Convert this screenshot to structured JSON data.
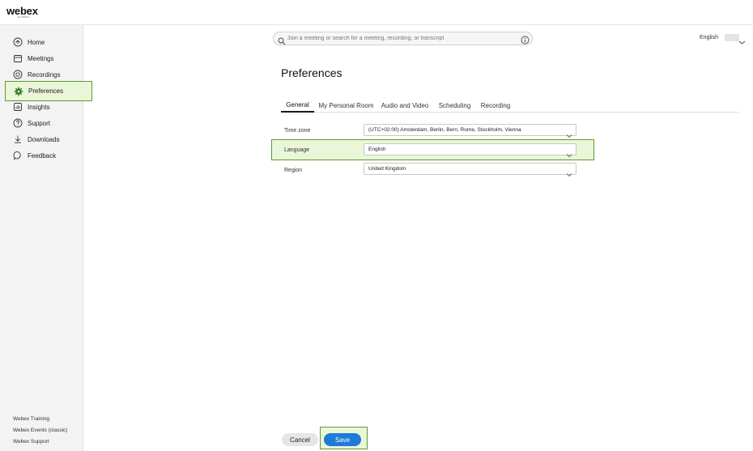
{
  "brand": {
    "logo_text": "webex",
    "logo_subtext": "by CISCO"
  },
  "search": {
    "placeholder": "Join a meeting or search for a meeting, recording, or transcript"
  },
  "header": {
    "language": "English"
  },
  "sidebar": {
    "items": [
      {
        "label": "Home",
        "icon": "home-icon"
      },
      {
        "label": "Meetings",
        "icon": "calendar-icon"
      },
      {
        "label": "Recordings",
        "icon": "record-icon"
      },
      {
        "label": "Preferences",
        "icon": "gear-icon"
      },
      {
        "label": "Insights",
        "icon": "chart-icon"
      },
      {
        "label": "Support",
        "icon": "help-icon"
      },
      {
        "label": "Downloads",
        "icon": "download-icon"
      },
      {
        "label": "Feedback",
        "icon": "feedback-icon"
      }
    ],
    "active_index": 3,
    "footer_links": [
      "Webex Training",
      "Webex Events (classic)",
      "Webex Support"
    ]
  },
  "main": {
    "title": "Preferences",
    "tabs": [
      {
        "label": "General"
      },
      {
        "label": "My Personal Room"
      },
      {
        "label": "Audio and Video"
      },
      {
        "label": "Scheduling"
      },
      {
        "label": "Recording"
      }
    ],
    "active_tab": 0,
    "fields": {
      "timezone": {
        "label": "Time zone",
        "value": "(UTC+02:00) Amsterdam, Berlin, Bern, Rome, Stockholm, Vienna"
      },
      "language": {
        "label": "Language",
        "value": "English"
      },
      "region": {
        "label": "Region",
        "value": "United Kingdom"
      }
    },
    "actions": {
      "cancel": "Cancel",
      "save": "Save"
    }
  },
  "colors": {
    "highlight_border": "#5a9d2e",
    "highlight_fill": "#e9f6d8",
    "primary": "#1f7ad8"
  }
}
